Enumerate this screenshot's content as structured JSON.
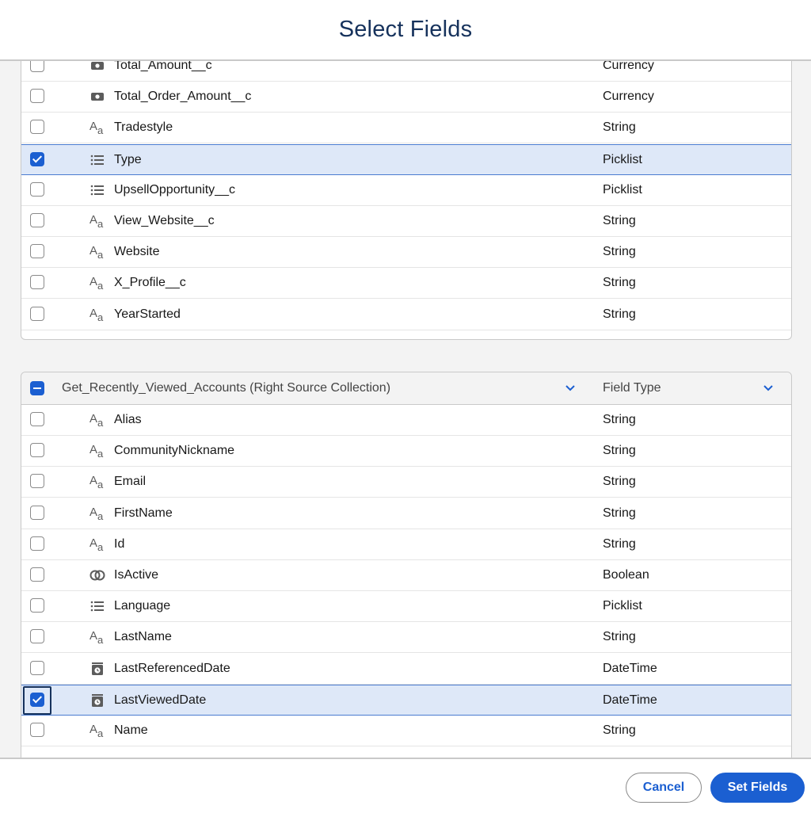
{
  "dialog": {
    "title": "Select Fields"
  },
  "panel1": {
    "rows": [
      {
        "name": "Total_Amount__c",
        "type": "Currency",
        "icon": "currency-icon",
        "checked": false
      },
      {
        "name": "Total_Order_Amount__c",
        "type": "Currency",
        "icon": "currency-icon",
        "checked": false
      },
      {
        "name": "Tradestyle",
        "type": "String",
        "icon": "text-icon",
        "checked": false
      },
      {
        "name": "Type",
        "type": "Picklist",
        "icon": "picklist-icon",
        "checked": true
      },
      {
        "name": "UpsellOpportunity__c",
        "type": "Picklist",
        "icon": "picklist-icon",
        "checked": false
      },
      {
        "name": "View_Website__c",
        "type": "String",
        "icon": "text-icon",
        "checked": false
      },
      {
        "name": "Website",
        "type": "String",
        "icon": "text-icon",
        "checked": false
      },
      {
        "name": "X_Profile__c",
        "type": "String",
        "icon": "text-icon",
        "checked": false
      },
      {
        "name": "YearStarted",
        "type": "String",
        "icon": "text-icon",
        "checked": false
      }
    ]
  },
  "panel2": {
    "header": {
      "label": "Get_Recently_Viewed_Accounts (Right Source Collection)",
      "type_label": "Field Type"
    },
    "rows": [
      {
        "name": "Alias",
        "type": "String",
        "icon": "text-icon",
        "checked": false
      },
      {
        "name": "CommunityNickname",
        "type": "String",
        "icon": "text-icon",
        "checked": false
      },
      {
        "name": "Email",
        "type": "String",
        "icon": "text-icon",
        "checked": false
      },
      {
        "name": "FirstName",
        "type": "String",
        "icon": "text-icon",
        "checked": false
      },
      {
        "name": "Id",
        "type": "String",
        "icon": "text-icon",
        "checked": false
      },
      {
        "name": "IsActive",
        "type": "Boolean",
        "icon": "boolean-icon",
        "checked": false
      },
      {
        "name": "Language",
        "type": "Picklist",
        "icon": "picklist-icon",
        "checked": false
      },
      {
        "name": "LastName",
        "type": "String",
        "icon": "text-icon",
        "checked": false
      },
      {
        "name": "LastReferencedDate",
        "type": "DateTime",
        "icon": "datetime-icon",
        "checked": false
      },
      {
        "name": "LastViewedDate",
        "type": "DateTime",
        "icon": "datetime-icon",
        "checked": true
      },
      {
        "name": "Name",
        "type": "String",
        "icon": "text-icon",
        "checked": false
      }
    ]
  },
  "footer": {
    "cancel_label": "Cancel",
    "set_label": "Set Fields"
  },
  "colors": {
    "brand": "#1b5fd1",
    "title": "#16325c",
    "selected_row": "#dee8f8"
  }
}
